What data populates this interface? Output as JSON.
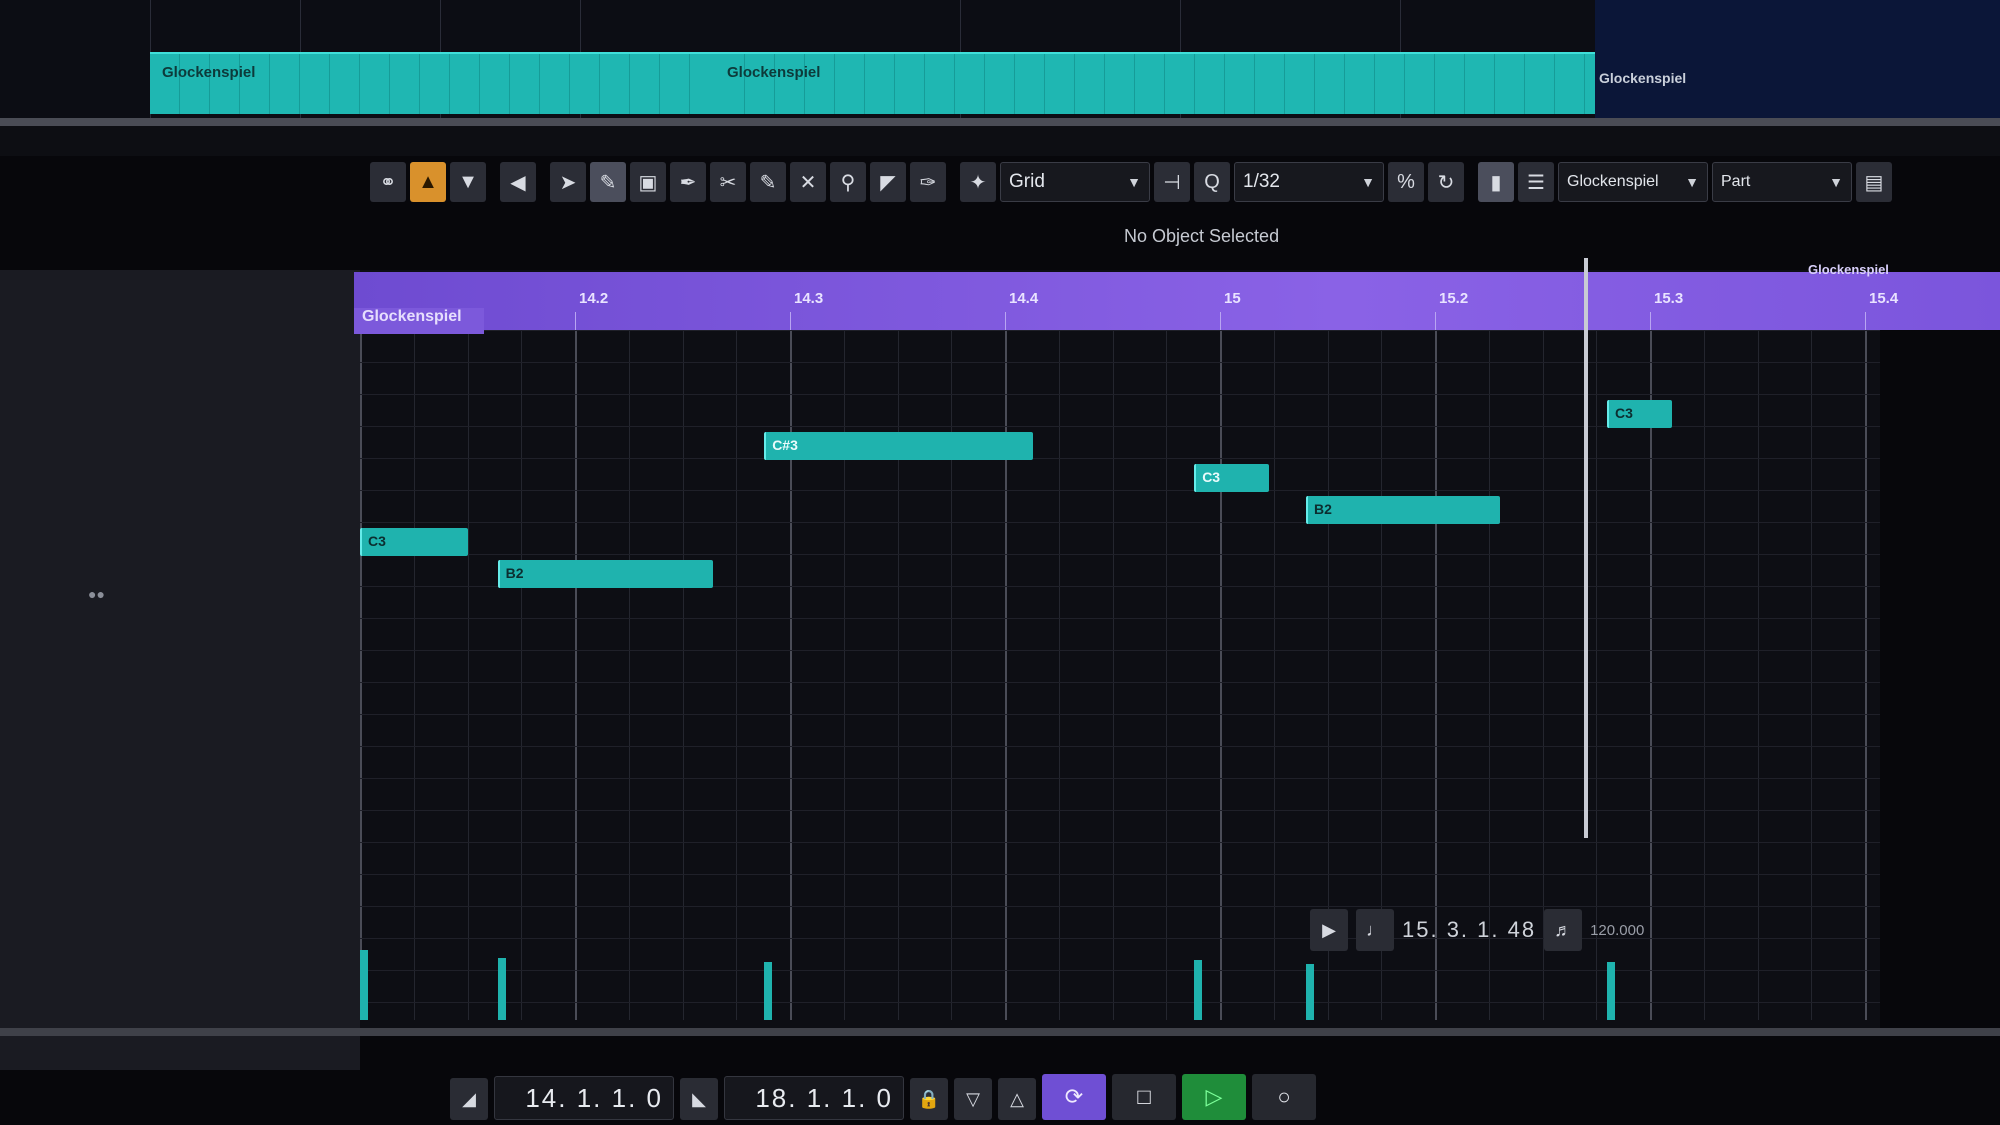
{
  "arrange": {
    "parts": [
      {
        "name": "Glockenspiel"
      },
      {
        "name": "Glockenspiel"
      },
      {
        "name": "Glockenspiel"
      }
    ]
  },
  "toolbar": {
    "snap_mode": "Grid",
    "quantize_label": "Q",
    "quantize_value": "1/32",
    "quantize_ratio_icon": "%",
    "track_name": "Glockenspiel",
    "part_mode": "Part",
    "icons": [
      "link-icon",
      "color-icon",
      "dropdown-icon",
      "play-left-icon",
      "pointer-icon",
      "pencil-icon",
      "eraser-icon",
      "line-icon",
      "scissors-icon",
      "glue-icon",
      "mute-icon",
      "zoom-icon",
      "draw-velocity-icon",
      "pen-icon",
      "snap-icon",
      "insert-icon",
      "quantize-icon"
    ]
  },
  "status": "No Object Selected",
  "ruler": {
    "part_name": "Glockenspiel",
    "end_part_name": "Glockenspiel",
    "labels": [
      "14.2",
      "14.3",
      "14.4",
      "15",
      "15.2",
      "15.3",
      "15.4"
    ]
  },
  "notes": [
    {
      "label": "C3",
      "start": 14.0,
      "pitch_row": 4
    },
    {
      "label": "B2",
      "start": 14.16,
      "pitch_row": 5
    },
    {
      "label": "C#3",
      "start": 14.47,
      "pitch_row": 1
    },
    {
      "label": "C3",
      "start": 14.97,
      "pitch_row": 2
    },
    {
      "label": "B2",
      "start": 15.1,
      "pitch_row": 3
    },
    {
      "label": "C3",
      "start": 15.45,
      "pitch_row": 0
    }
  ],
  "transport": {
    "left_locator": "14. 1. 1.    0",
    "right_locator": "18. 1. 1.    0",
    "position": "15. 3. 1. 48",
    "tempo": "120.000",
    "buttons": {
      "cycle": "cycle",
      "stop": "stop",
      "play": "play",
      "record": "record"
    }
  },
  "colors": {
    "note": "#1fb3ae",
    "ruler": "#7b55dc",
    "playing": "#1f8d3a",
    "cycle": "#6f4fd4"
  }
}
